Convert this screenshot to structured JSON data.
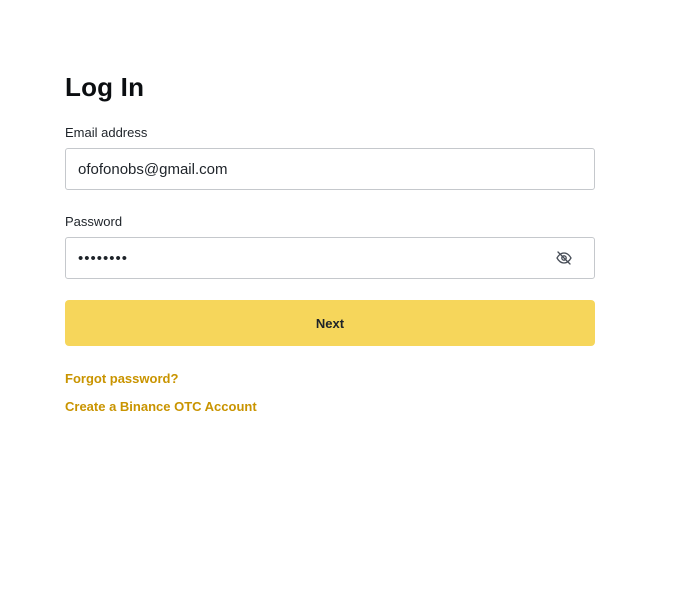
{
  "page": {
    "title": "Log In"
  },
  "form": {
    "email": {
      "label": "Email address",
      "value": "ofofonobs@gmail.com"
    },
    "password": {
      "label": "Password",
      "masked_value": "••••••••",
      "toggle_icon": "eye-slash-icon"
    },
    "next_label": "Next",
    "forgot_password_label": "Forgot password?",
    "create_account_label": "Create a Binance OTC Account"
  },
  "colors": {
    "accent_button": "#F6D65B",
    "link": "#C99400",
    "text": "#1E2329",
    "input_border": "#C5C8CC"
  }
}
